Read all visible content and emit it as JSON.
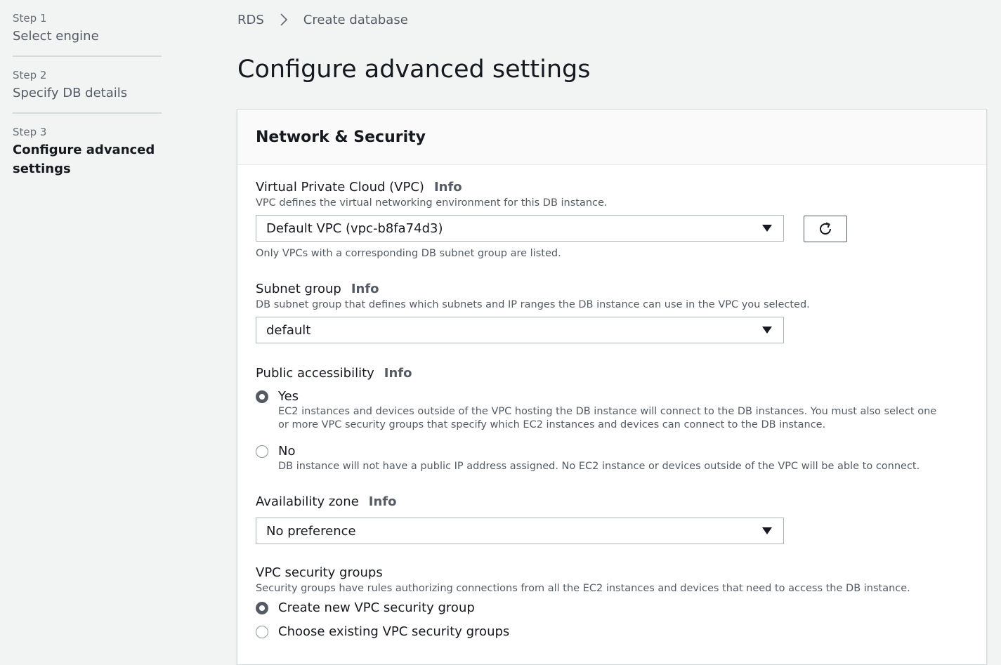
{
  "sidebar": {
    "steps": [
      {
        "number": "Step 1",
        "title": "Select engine"
      },
      {
        "number": "Step 2",
        "title": "Specify DB details"
      },
      {
        "number": "Step 3",
        "title": "Configure advanced settings"
      }
    ]
  },
  "breadcrumb": {
    "root": "RDS",
    "current": "Create database"
  },
  "page": {
    "title": "Configure advanced settings"
  },
  "panel": {
    "title": "Network & Security",
    "info_label": "Info",
    "vpc": {
      "label": "Virtual Private Cloud (VPC)",
      "description": "VPC defines the virtual networking environment for this DB instance.",
      "value": "Default VPC (vpc-b8fa74d3)",
      "constraint": "Only VPCs with a corresponding DB subnet group are listed."
    },
    "subnet": {
      "label": "Subnet group",
      "description": "DB subnet group that defines which subnets and IP ranges the DB instance can use in the VPC you selected.",
      "value": "default"
    },
    "public_access": {
      "label": "Public accessibility",
      "options": [
        {
          "label": "Yes",
          "description": "EC2 instances and devices outside of the VPC hosting the DB instance will connect to the DB instances. You must also select one or more VPC security groups that specify which EC2 instances and devices can connect to the DB instance.",
          "selected": true
        },
        {
          "label": "No",
          "description": "DB instance will not have a public IP address assigned. No EC2 instance or devices outside of the VPC will be able to connect.",
          "selected": false
        }
      ]
    },
    "availability_zone": {
      "label": "Availability zone",
      "value": "No preference"
    },
    "security_groups": {
      "label": "VPC security groups",
      "description": "Security groups have rules authorizing connections from all the EC2 instances and devices that need to access the DB instance.",
      "options": [
        {
          "label": "Create new VPC security group",
          "selected": true
        },
        {
          "label": "Choose existing VPC security groups",
          "selected": false
        }
      ]
    }
  },
  "icons": {
    "breadcrumb_separator": "chevron-right-icon",
    "dropdown": "caret-down-icon",
    "refresh": "refresh-icon"
  },
  "colors": {
    "text": "#16191f",
    "muted": "#545b64",
    "border": "#aab7b8",
    "background": "#f2f3f3"
  }
}
